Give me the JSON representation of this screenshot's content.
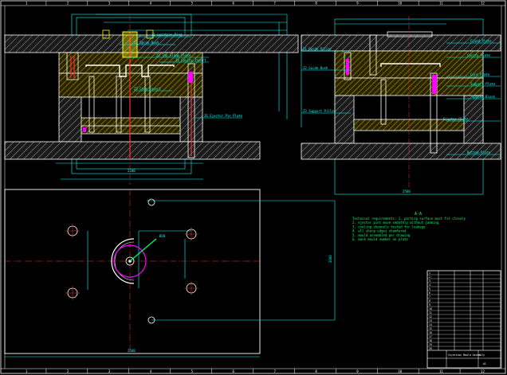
{
  "drawing": {
    "view_label": "A-A",
    "grid_numbers": [
      "1",
      "2",
      "3",
      "4",
      "5",
      "6",
      "7",
      "8",
      "9",
      "10",
      "11",
      "12"
    ],
    "dim_front_width": "2200",
    "dim_side_width": "2560",
    "dim_plate_width": "2560",
    "dim_plate_height": "2000",
    "dim_hole": "Ø20"
  },
  "front_callouts": [
    "Z1 Location Ring",
    "Z2 Sprue Bush",
    "Z3 Top Clamp Plate",
    "Z4 Cavity Insert",
    "Z5 Core Insert",
    "Z6 Ejector Pin Plate"
  ],
  "side_callouts_left": [
    "Z1 Guide Pillar",
    "Z2 Guide Bush",
    "Z3 Support Pillar"
  ],
  "side_callouts_right": [
    "Fixed Plate",
    "Cavity Plate",
    "Core Plate",
    "Support Plate",
    "Spacer Block",
    "Ejector Plate",
    "Bottom Plate"
  ],
  "tech_notes": [
    "Technical requirements: 1. parting surface must fit closely",
    "2. ejector pins move smoothly without jamming",
    "3. cooling channels tested for leakage",
    "4. all sharp edges chamfered",
    "5. mould assembled per drawing",
    "6. mark mould number on plate"
  ],
  "title_block": {
    "rows": [
      "1",
      "2",
      "3",
      "4",
      "5",
      "6",
      "7",
      "8",
      "9",
      "10",
      "11",
      "12",
      "13",
      "14",
      "15",
      "16",
      "17",
      "18",
      "19",
      "20"
    ],
    "title": "Injection Mould Assembly",
    "sheet": "A1"
  }
}
